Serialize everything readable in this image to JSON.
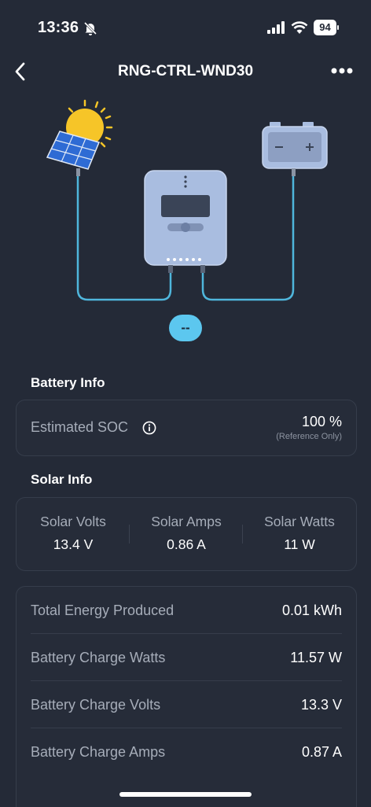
{
  "status_bar": {
    "time": "13:36",
    "battery": "94",
    "icons": [
      "bell-slash-icon",
      "signal-icon",
      "wifi-icon",
      "battery-icon"
    ]
  },
  "header": {
    "title": "RNG-CTRL-WND30",
    "back_icon": "chevron-left-icon",
    "more_icon": "more-horizontal-icon"
  },
  "diagram": {
    "status_badge": "--",
    "icons": [
      "solar-panel-icon",
      "charge-controller-icon",
      "battery-icon"
    ],
    "wire_color": "#4fb6dc"
  },
  "battery_info": {
    "title": "Battery Info",
    "soc_label": "Estimated SOC",
    "soc_value": "100 %",
    "soc_note": "(Reference Only)"
  },
  "solar_info": {
    "title": "Solar Info",
    "items": [
      {
        "label": "Solar Volts",
        "value": "13.4 V"
      },
      {
        "label": "Solar Amps",
        "value": "0.86 A"
      },
      {
        "label": "Solar Watts",
        "value": "11 W"
      }
    ]
  },
  "details": [
    {
      "label": "Total Energy Produced",
      "value": "0.01 kWh"
    },
    {
      "label": "Battery Charge Watts",
      "value": "11.57 W"
    },
    {
      "label": "Battery Charge Volts",
      "value": "13.3 V"
    },
    {
      "label": "Battery Charge Amps",
      "value": "0.87 A"
    }
  ],
  "colors": {
    "background": "#242a37",
    "card_border": "#363d4b",
    "accent": "#5cc7ef",
    "muted_text": "#a6adb9"
  }
}
